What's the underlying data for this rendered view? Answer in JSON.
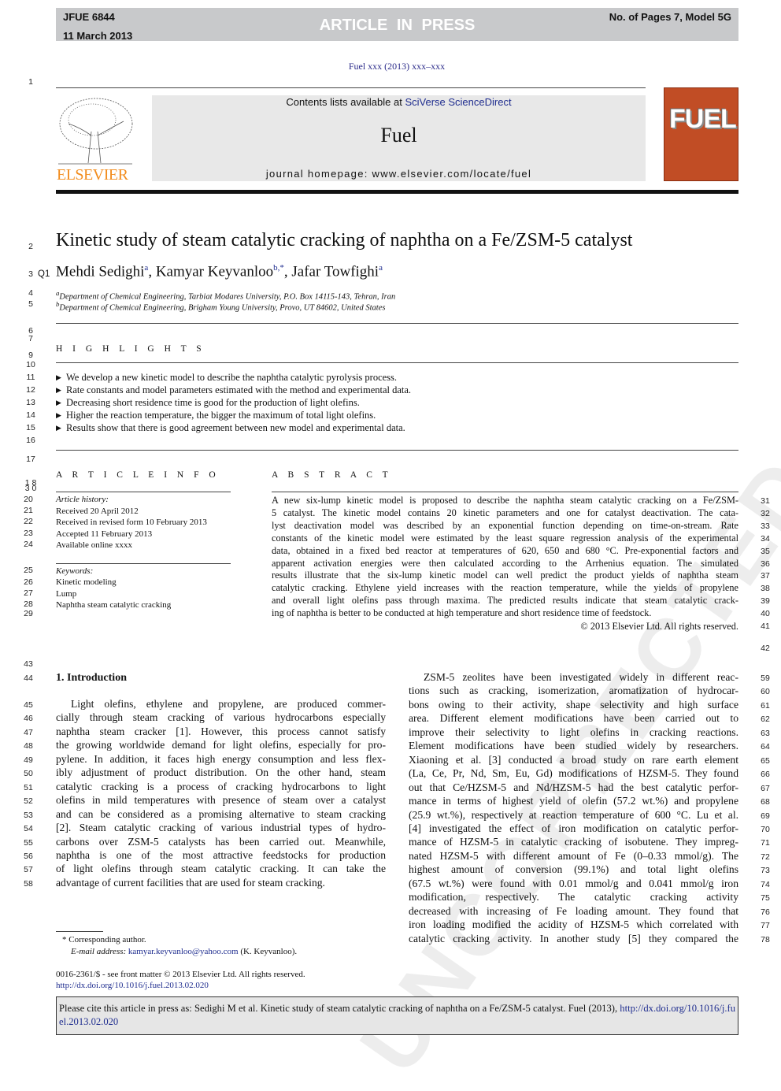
{
  "header": {
    "id": "JFUE 6844",
    "date": "11 March 2013",
    "status": "ARTICLE IN PRESS",
    "pages": "No. of Pages 7, Model 5G"
  },
  "citation_line": "Fuel xxx (2013) xxx–xxx",
  "masthead": {
    "contents_prefix": "Contents lists available at ",
    "sciencedirect": "SciVerse ScienceDirect",
    "journal": "Fuel",
    "homepage": "journal homepage: www.elsevier.com/locate/fuel",
    "publisher": "ELSEVIER",
    "cover_title": "FUEL"
  },
  "article": {
    "title": "Kinetic study of steam catalytic cracking of naphtha on a Fe/ZSM-5 catalyst",
    "query": "Q1",
    "authors": [
      {
        "name": "Mehdi Sedighi",
        "sup": "a"
      },
      {
        "name": "Kamyar Keyvanloo",
        "sup": "b,*"
      },
      {
        "name": "Jafar Towfighi",
        "sup": "a"
      }
    ],
    "affiliations": [
      {
        "sup": "a",
        "text": "Department of Chemical Engineering, Tarbiat Modares University, P.O. Box 14115-143, Tehran, Iran"
      },
      {
        "sup": "b",
        "text": "Department of Chemical Engineering, Brigham Young University, Provo, UT 84602, United States"
      }
    ]
  },
  "highlights": {
    "heading": "H I G H L I G H T S",
    "items": [
      "We develop a new kinetic model to describe the naphtha catalytic pyrolysis process.",
      "Rate constants and model parameters estimated with the method and experimental data.",
      "Decreasing short residence time is good for the production of light olefins.",
      "Higher the reaction temperature, the bigger the maximum of total light olefins.",
      "Results show that there is good agreement between new model and experimental data."
    ]
  },
  "article_info": {
    "heading": "A R T I C L E   I N F O",
    "history_label": "Article history:",
    "history": [
      "Received 20 April 2012",
      "Received in revised form 10 February 2013",
      "Accepted 11 February 2013",
      "Available online xxxx"
    ],
    "keywords_label": "Keywords:",
    "keywords": [
      "Kinetic modeling",
      "Lump",
      "Naphtha steam catalytic cracking"
    ]
  },
  "abstract": {
    "heading": "A B S T R A C T",
    "lines": [
      "A new six-lump kinetic model is proposed to describe the naphtha steam catalytic cracking on a Fe/ZSM-",
      "5 catalyst. The kinetic model contains 20 kinetic parameters and one for catalyst deactivation. The cata-",
      "lyst deactivation model was described by an exponential function depending on time-on-stream. Rate",
      "constants of the kinetic model were estimated by the least square regression analysis of the experimental",
      "data, obtained in a fixed bed reactor at temperatures of 620, 650 and 680 °C. Pre-exponential factors and",
      "apparent activation energies were then calculated according to the Arrhenius equation. The simulated",
      "results illustrate that the six-lump kinetic model can well predict the product yields of naphtha steam",
      "catalytic cracking. Ethylene yield increases with the reaction temperature, while the yields of propylene",
      "and overall light olefins pass through maxima. The predicted results indicate that steam catalytic crack-",
      "ing of naphtha is better to be conducted at high temperature and short residence time of feedstock."
    ],
    "copyright": "© 2013 Elsevier Ltd. All rights reserved."
  },
  "intro": {
    "heading": "1. Introduction",
    "left_lines": [
      "Light olefins, ethylene and propylene, are produced commer-",
      "cially through steam cracking of various hydrocarbons especially",
      "naphtha steam cracker [1]. However, this process cannot satisfy",
      "the growing worldwide demand for light olefins, especially for pro-",
      "pylene. In addition, it faces high energy consumption and less flex-",
      "ibly adjustment of product distribution. On the other hand, steam",
      "catalytic cracking is a process of cracking hydrocarbons to light",
      "olefins in mild temperatures with presence of steam over a catalyst",
      "and can be considered as a promising alternative to steam cracking",
      "[2]. Steam catalytic cracking of various industrial types of hydro-",
      "carbons over ZSM-5 catalysts has been carried out. Meanwhile,",
      "naphtha is one of the most attractive feedstocks for production",
      "of light olefins through steam catalytic cracking. It can take the",
      "advantage of current facilities that are used for steam cracking."
    ],
    "right_lines": [
      "ZSM-5 zeolites have been investigated widely in different reac-",
      "tions such as cracking, isomerization, aromatization of hydrocar-",
      "bons owing to their activity, shape selectivity and high surface",
      "area. Different element modifications have been carried out to",
      "improve their selectivity to light olefins in cracking reactions.",
      "Element modifications have been studied widely by researchers.",
      "Xiaoning et al. [3] conducted a broad study on rare earth element",
      "(La, Ce, Pr, Nd, Sm, Eu, Gd) modifications of HZSM-5. They found",
      "out that Ce/HZSM-5 and Nd/HZSM-5 had the best catalytic perfor-",
      "mance in terms of highest yield of olefin (57.2 wt.%) and propylene",
      "(25.9 wt.%), respectively at reaction temperature of 600 °C. Lu et al.",
      "[4] investigated the effect of iron modification on catalytic perfor-",
      "mance of HZSM-5 in catalytic cracking of isobutene. They impreg-",
      "nated HZSM-5 with different amount of Fe (0–0.33 mmol/g). The",
      "highest amount of conversion (99.1%) and total light olefins",
      "(67.5 wt.%) were found with 0.01 mmol/g and 0.041 mmol/g iron",
      "modification, respectively. The catalytic cracking activity",
      "decreased with increasing of Fe loading amount. They found that",
      "iron loading modified the acidity of HZSM-5 which correlated with",
      "catalytic cracking activity. In another study [5] they compared the"
    ]
  },
  "footnote": {
    "corresponding": "* Corresponding author.",
    "email_label": "E-mail address: ",
    "email": "kamyar.keyvanloo@yahoo.com",
    "email_suffix": " (K. Keyvanloo).",
    "issn": "0016-2361/$ - see front matter © 2013 Elsevier Ltd. All rights reserved.",
    "doi": "http://dx.doi.org/10.1016/j.fuel.2013.02.020"
  },
  "cite_box": {
    "text": "Please cite this article in press as: Sedighi M et al. Kinetic study of steam catalytic cracking of naphtha on a Fe/ZSM-5 catalyst. Fuel (2013), ",
    "link": "http://dx.doi.org/10.1016/j.fuel.2013.02.020"
  },
  "watermark": "UNCORRECTED PROOF",
  "line_numbers": {
    "left_misc": [
      "1",
      "2",
      "3",
      "4",
      "5",
      "6",
      "7",
      "9",
      "10",
      "11",
      "12",
      "13",
      "14",
      "15",
      "16",
      "17",
      "1 8",
      "3 0"
    ],
    "info": [
      "20",
      "21",
      "22",
      "23",
      "24",
      "25",
      "26",
      "27",
      "28",
      "29"
    ],
    "intro_left": [
      "43",
      "44",
      "45",
      "46",
      "47",
      "48",
      "49",
      "50",
      "51",
      "52",
      "53",
      "54",
      "55",
      "56",
      "57",
      "58"
    ],
    "abstract_right": [
      "31",
      "32",
      "33",
      "34",
      "35",
      "36",
      "37",
      "38",
      "39",
      "40",
      "41",
      "42"
    ],
    "intro_right": [
      "59",
      "60",
      "61",
      "62",
      "63",
      "64",
      "65",
      "66",
      "67",
      "68",
      "69",
      "70",
      "71",
      "72",
      "73",
      "74",
      "75",
      "76",
      "77",
      "78"
    ]
  },
  "colors": {
    "header_bar": "#c8c9cb",
    "link": "#1f2d8f",
    "elsevier": "#f28c1d",
    "cover": "#c14d25"
  }
}
